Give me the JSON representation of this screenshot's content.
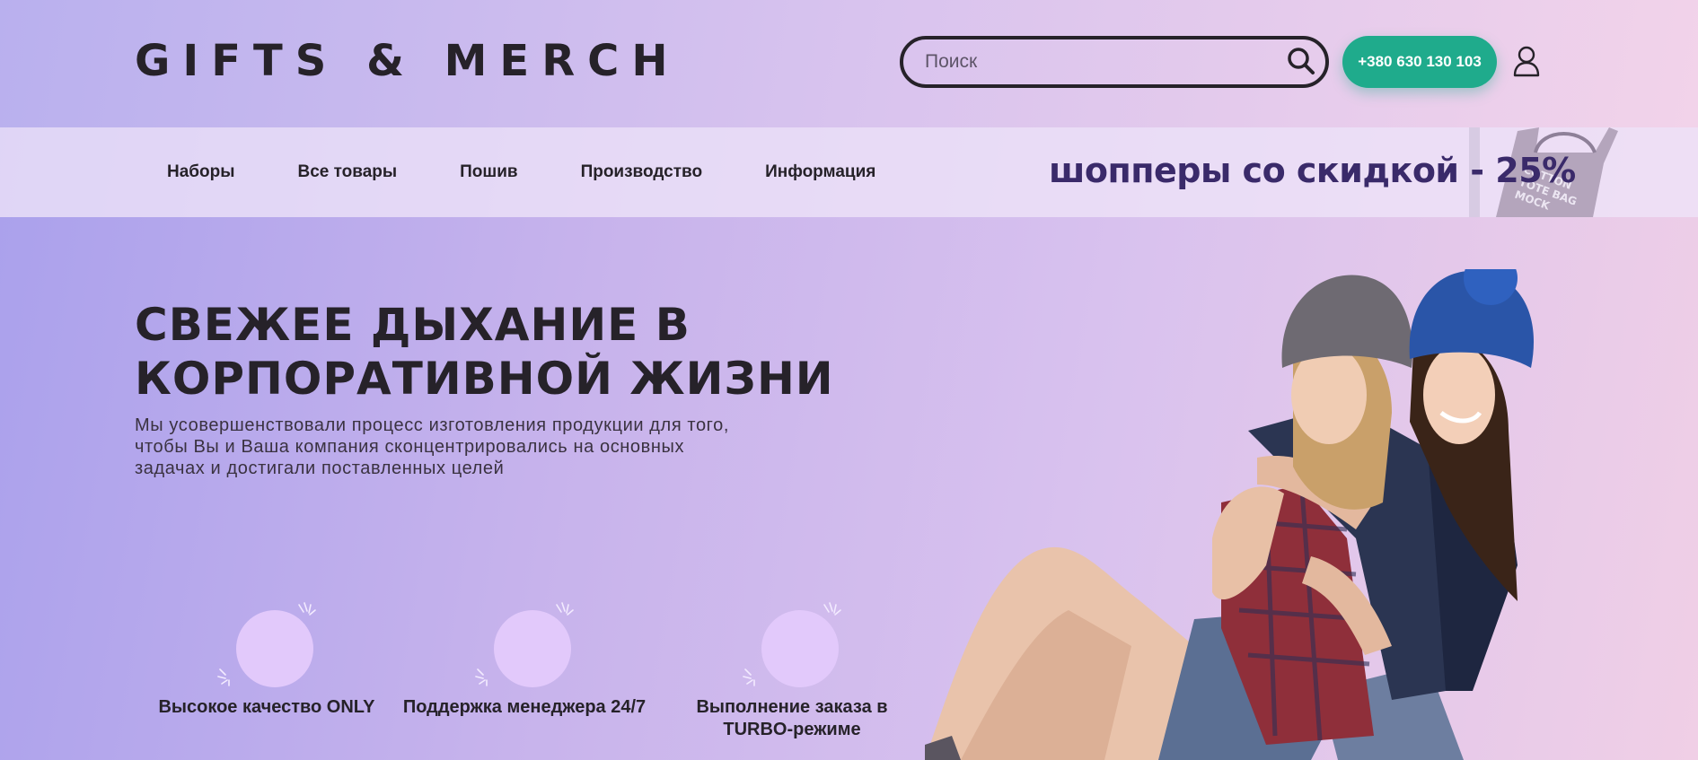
{
  "header": {
    "logo": "GIFTS & MERCH",
    "search_placeholder": "Поиск",
    "phone": "+380 630 130 103"
  },
  "nav": {
    "items": [
      "Наборы",
      "Все товары",
      "Пошив",
      "Производство",
      "Информация"
    ],
    "promo": "шопперы со скидкой - 25%",
    "promo_bag_text": "COTTON TOTE BAG MOCK"
  },
  "hero": {
    "title_line1": "СВЕЖЕЕ ДЫХАНИЕ В",
    "title_line2": "КОРПОРАТИВНОЙ ЖИЗНИ",
    "subtitle_line1": "Мы усовершенствовали процесс изготовления продукции для того,",
    "subtitle_line2": "чтобы Вы и Ваша компания сконцентрировались на основных",
    "subtitle_line3": "задачах и достигали поставленных целей"
  },
  "features": [
    {
      "text": "Высокое качество ",
      "highlight": "ONLY"
    },
    {
      "text": "Поддержка менеджера ",
      "highlight": "24/7"
    },
    {
      "text": "Выполнение заказа в ",
      "highlight": "TURBO-режиме"
    }
  ],
  "colors": {
    "accent": "#1fab8c",
    "text": "#262229",
    "promo": "#3a2a6a",
    "feature_circle": "#e2c9fb"
  }
}
